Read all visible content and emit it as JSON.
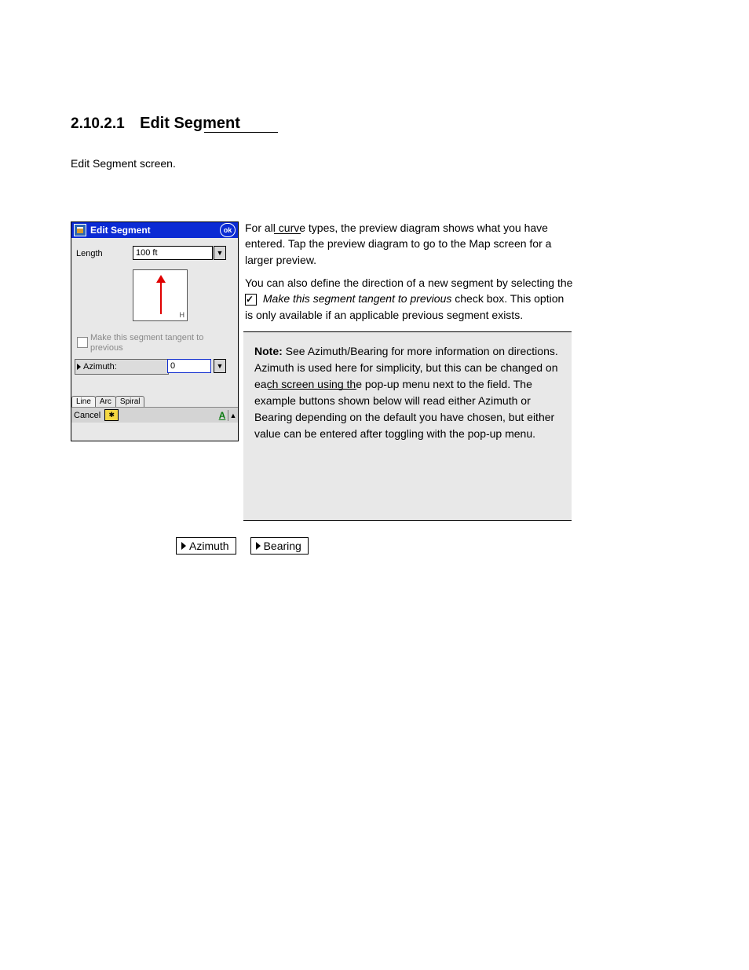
{
  "heading": {
    "num": "2.10.2.1",
    "title": "Edit Segment"
  },
  "p1": "Edit Segment screen.",
  "p2_prefix": "For all curve types, the preview diagram shows what you have entered. Tap the preview diagram to go to the ",
  "p2_link": "Map",
  "p2_suffix": " screen for a larger preview.",
  "p3_prefix": "You can also define the direction of a new segment by selecting the ",
  "p3_ck": "Make this segment tangent to previous",
  "p3_suffix": " check box. This option is only available if an applicable previous segment exists.",
  "note": {
    "label": "Note:",
    "t1_prefix": "See ",
    "t1_link": "Azimuth/Bearing",
    "t1_suffix": " for more information on directions. Azimuth is used here for simplicity, but this can be changed on each screen using the pop-up menu next to the field. The example buttons shown below will read either Azimuth or Bearing depending on the default you have chosen, but either value can be entered after toggling with the pop-up menu."
  },
  "btn_az": "Azimuth",
  "btn_bearing": "Bearing",
  "win": {
    "title": "Edit Segment",
    "ok": "ok",
    "length_label": "Length",
    "length_value": "100 ft",
    "h": "H",
    "ck_label": "Make this segment tangent to previous",
    "az_label": "Azimuth:",
    "az_value": "0",
    "tabs": {
      "line": "Line",
      "arc": "Arc",
      "spiral": "Spiral"
    },
    "cancel": "Cancel",
    "sip": "✱"
  }
}
